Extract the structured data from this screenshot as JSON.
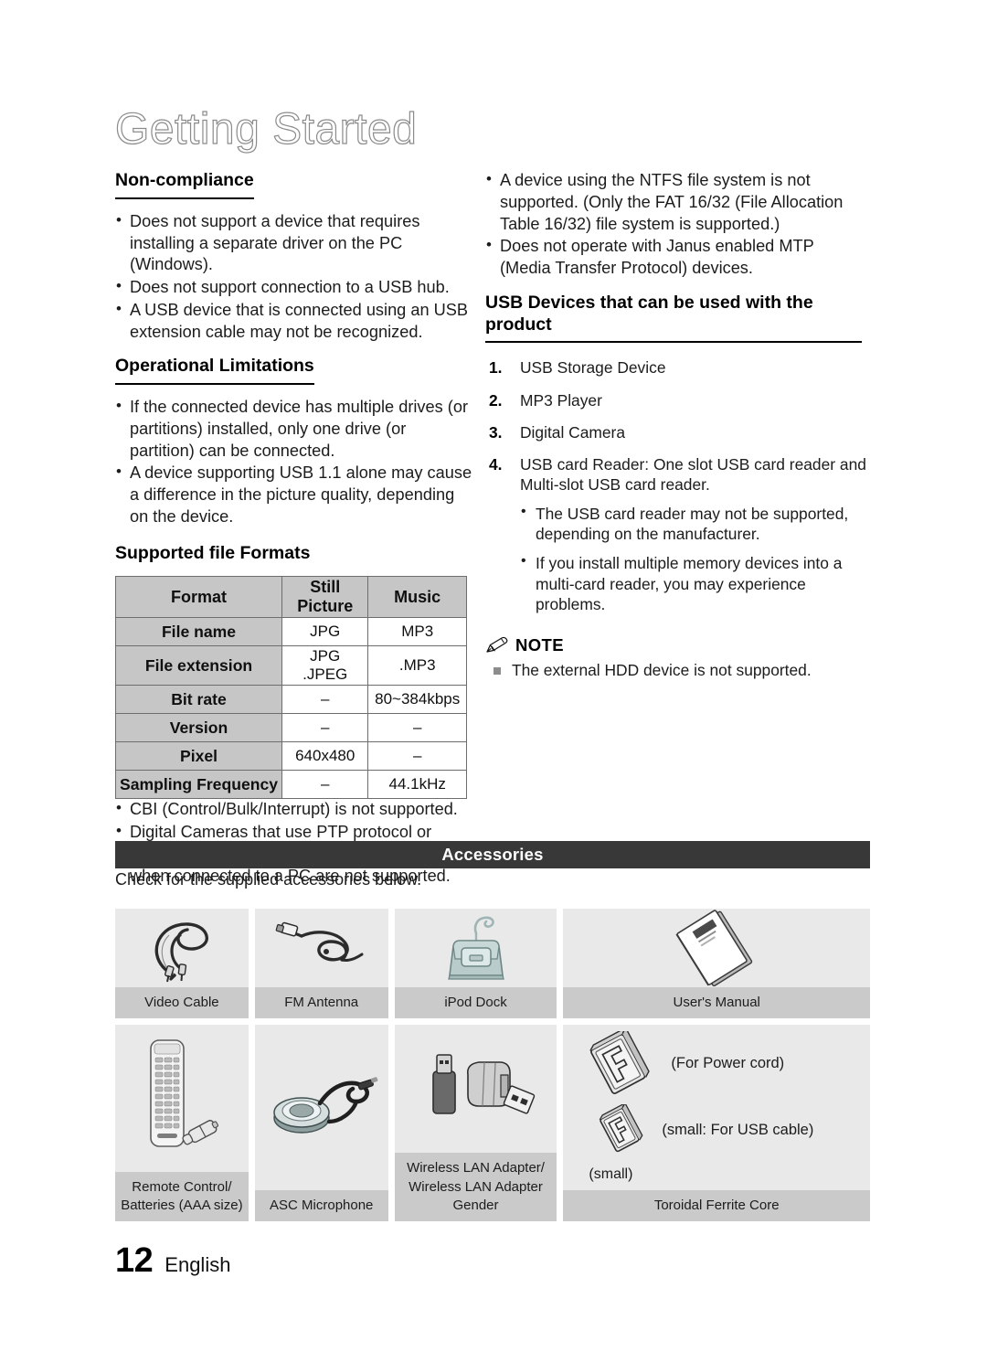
{
  "chapter": {
    "title": "Getting Started"
  },
  "left_column": {
    "non_compliance": {
      "heading": "Non-compliance",
      "bullets": [
        "Does not support a device that requires installing a separate driver on the PC (Windows).",
        "Does not support connection to a USB hub.",
        "A USB device that is connected using an USB extension cable may not be recognized."
      ]
    },
    "operational_limitations": {
      "heading": "Operational Limitations",
      "bullets": [
        "If the connected device has multiple drives (or partitions) installed, only one drive (or partition) can be connected.",
        "A device supporting USB 1.1 alone may cause a difference in the picture quality, depending on the device."
      ]
    },
    "supported_formats": {
      "heading": "Supported file Formats",
      "table": {
        "headers": [
          "Format",
          "Still Picture",
          "Music"
        ],
        "rows": [
          {
            "label": "File name",
            "still": "JPG",
            "music": "MP3"
          },
          {
            "label": "File extension",
            "still": "JPG .JPEG",
            "music": ".MP3"
          },
          {
            "label": "Bit rate",
            "still": "–",
            "music": "80~384kbps"
          },
          {
            "label": "Version",
            "still": "–",
            "music": "–"
          },
          {
            "label": "Pixel",
            "still": "640x480",
            "music": "–"
          },
          {
            "label": "Sampling Frequency",
            "still": "–",
            "music": "44.1kHz"
          }
        ]
      },
      "after_bullets": [
        "CBI (Control/Bulk/Interrupt) is not supported.",
        "Digital Cameras that use PTP protocol or require additional programme installation when connected to a PC are not supported."
      ]
    }
  },
  "right_column": {
    "top_bullets": [
      "A device using the NTFS file system is not supported. (Only the FAT 16/32 (File Allocation Table 16/32) file system is supported.)",
      "Does not operate with Janus enabled MTP (Media Transfer Protocol) devices."
    ],
    "usb_devices": {
      "heading": "USB Devices that can be used with the product",
      "items": [
        {
          "num": "1.",
          "text": "USB Storage Device"
        },
        {
          "num": "2.",
          "text": "MP3 Player"
        },
        {
          "num": "3.",
          "text": "Digital Camera"
        },
        {
          "num": "4.",
          "text": "USB card Reader: One slot USB card reader and Multi-slot USB card reader."
        }
      ],
      "sub_bullets": [
        "The USB card reader may not be supported, depending on the manufacturer.",
        "If you install multiple memory devices into a multi-card reader, you may experience problems."
      ]
    },
    "note": {
      "label": "NOTE",
      "items": [
        "The external HDD device is not supported."
      ]
    }
  },
  "accessories": {
    "band_title": "Accessories",
    "subtitle": "Check for the supplied accessories below.",
    "row1": [
      {
        "caption": "Video Cable",
        "icon": "video-cable-icon"
      },
      {
        "caption": "FM Antenna",
        "icon": "fm-antenna-icon"
      },
      {
        "caption": "iPod Dock",
        "icon": "ipod-dock-icon"
      },
      {
        "caption": "User's Manual",
        "icon": "users-manual-icon"
      }
    ],
    "row2": [
      {
        "caption_l1": "Remote Control/",
        "caption_l2": "Batteries (AAA size)",
        "icon": "remote-control-icon"
      },
      {
        "caption_l1": "ASC Microphone",
        "caption_l2": "",
        "icon": "asc-microphone-icon"
      },
      {
        "caption_l1": "Wireless LAN Adapter/",
        "caption_l2": "Wireless LAN Adapter Gender",
        "icon": "wireless-lan-adapter-icon"
      },
      {
        "caption_l1": "Toroidal Ferrite Core",
        "caption_l2": "",
        "icon": "toroidal-ferrite-core-icon"
      }
    ],
    "ferrite": {
      "label_power": "(For Power cord)",
      "label_usb": "(small: For USB cable)",
      "label_small": "(small)"
    }
  },
  "footer": {
    "page_number": "12",
    "language": "English"
  },
  "colors": {
    "band_bg": "#383838",
    "table_header_bg": "#c6c6c6",
    "cell_bg": "#e9e9e9",
    "caption_bg": "#cacaca",
    "title_outline": "#8b8b8b"
  }
}
